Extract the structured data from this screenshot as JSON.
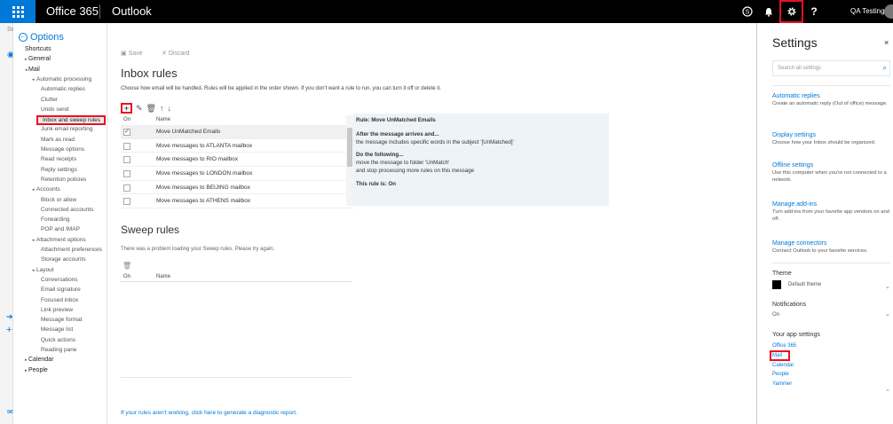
{
  "topbar": {
    "suite_name": "Office 365",
    "app_name": "Outlook",
    "user_name": "QA Testing",
    "accent_color": "#0078d7",
    "highlight_color": "#e81123",
    "icons": [
      "skype-icon",
      "bell-icon",
      "gear-icon",
      "help-icon"
    ],
    "help_glyph": "?"
  },
  "left_strip": {
    "truncated_text": "Se"
  },
  "options": {
    "back_label": "Options",
    "nav": [
      {
        "label": "Shortcuts",
        "level": 1
      },
      {
        "label": "General",
        "level": 1,
        "arrow": "▸"
      },
      {
        "label": "Mail",
        "level": 1,
        "arrow": "◂"
      },
      {
        "label": "Automatic processing",
        "level": 2,
        "arrow": "◂"
      },
      {
        "label": "Automatic replies",
        "level": 3
      },
      {
        "label": "Clutter",
        "level": 3
      },
      {
        "label": "Undo send",
        "level": 3
      },
      {
        "label": "Inbox and sweep rules",
        "level": 3,
        "selected": true
      },
      {
        "label": "Junk email reporting",
        "level": 3
      },
      {
        "label": "Mark as read",
        "level": 3
      },
      {
        "label": "Message options",
        "level": 3
      },
      {
        "label": "Read receipts",
        "level": 3
      },
      {
        "label": "Reply settings",
        "level": 3
      },
      {
        "label": "Retention policies",
        "level": 3
      },
      {
        "label": "Accounts",
        "level": 2,
        "arrow": "◂"
      },
      {
        "label": "Block or allow",
        "level": 3
      },
      {
        "label": "Connected accounts",
        "level": 3
      },
      {
        "label": "Forwarding",
        "level": 3
      },
      {
        "label": "POP and IMAP",
        "level": 3
      },
      {
        "label": "Attachment options",
        "level": 2,
        "arrow": "◂"
      },
      {
        "label": "Attachment preferences",
        "level": 3
      },
      {
        "label": "Storage accounts",
        "level": 3
      },
      {
        "label": "Layout",
        "level": 2,
        "arrow": "◂"
      },
      {
        "label": "Conversations",
        "level": 3
      },
      {
        "label": "Email signature",
        "level": 3
      },
      {
        "label": "Focused inbox",
        "level": 3
      },
      {
        "label": "Link preview",
        "level": 3
      },
      {
        "label": "Message format",
        "level": 3
      },
      {
        "label": "Message list",
        "level": 3
      },
      {
        "label": "Quick actions",
        "level": 3
      },
      {
        "label": "Reading pane",
        "level": 3
      },
      {
        "label": "Calendar",
        "level": 1,
        "arrow": "▸"
      },
      {
        "label": "People",
        "level": 1,
        "arrow": "▸"
      }
    ]
  },
  "toolbar": {
    "save_label": "Save",
    "discard_label": "Discard"
  },
  "inbox_rules": {
    "title": "Inbox rules",
    "description": "Choose how email will be handled. Rules will be applied in the order shown. If you don't want a rule to run, you can turn it off or delete it.",
    "col_on": "On",
    "col_name": "Name",
    "rules": [
      {
        "name": "Move UnMatched Emails",
        "on": true,
        "selected": true
      },
      {
        "name": "Move messages to ATLANTA mailbox",
        "on": false
      },
      {
        "name": "Move messages to RIO mailbox",
        "on": false
      },
      {
        "name": "Move messages to LONDON mailbox",
        "on": false
      },
      {
        "name": "Move messages to BEIJING mailbox",
        "on": false
      },
      {
        "name": "Move messages to ATHENS mailbox",
        "on": false
      }
    ],
    "detail": {
      "rule_line": "Rule: Move UnMatched Emails",
      "after_heading": "After the message arrives and...",
      "condition": "the message includes specific words in the subject '[UnMatched]'",
      "do_heading": "Do the following...",
      "action1": "move the message to folder 'UnMatch'",
      "action2": "and stop processing more rules on this message",
      "status": "This rule is: On"
    }
  },
  "sweep_rules": {
    "title": "Sweep rules",
    "message": "There was a problem loading your Sweep rules. Please try again.",
    "col_on": "On",
    "col_name": "Name"
  },
  "diagnostic_link": "If your rules aren't working, click here to generate a diagnostic report.",
  "settings": {
    "title": "Settings",
    "close_glyph": "×",
    "search_placeholder": "Search all settings",
    "sections": [
      {
        "title": "Automatic replies",
        "desc": "Create an automatic reply (Out of office) message."
      },
      {
        "title": "Display settings",
        "desc": "Choose how your Inbox should be organized."
      },
      {
        "title": "Offline settings",
        "desc": "Use this computer when you're not connected to a network."
      },
      {
        "title": "Manage add-ins",
        "desc": "Turn add-ins from your favorite app vendors on and off."
      },
      {
        "title": "Manage connectors",
        "desc": "Connect Outlook to your favorite services."
      }
    ],
    "theme_label": "Theme",
    "theme_value": "Default theme",
    "notifications_label": "Notifications",
    "notifications_value": "On",
    "app_settings_label": "Your app settings",
    "app_settings": [
      "Office 365",
      "Mail",
      "Calendar",
      "People",
      "Yammer"
    ]
  }
}
